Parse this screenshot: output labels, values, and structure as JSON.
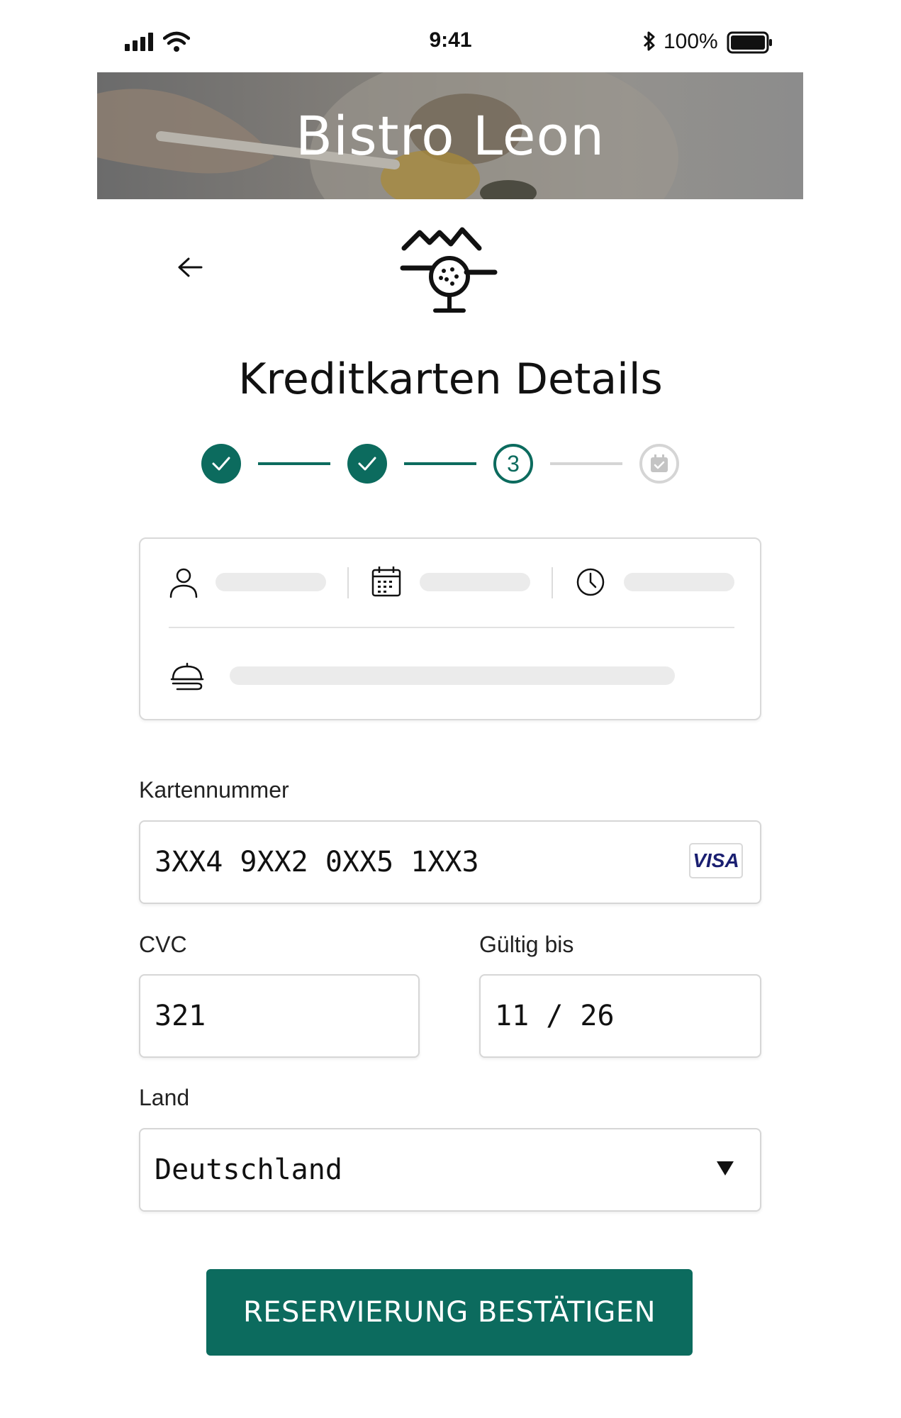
{
  "status_bar": {
    "time": "9:41",
    "battery_percent": "100%"
  },
  "hero": {
    "restaurant_name": "Bistro Leon"
  },
  "page": {
    "title": "Kreditkarten Details"
  },
  "stepper": {
    "steps": [
      {
        "state": "done"
      },
      {
        "state": "done"
      },
      {
        "state": "current",
        "label": "3"
      },
      {
        "state": "pending",
        "icon": "calendar-check-icon"
      }
    ]
  },
  "form": {
    "card_number": {
      "label": "Kartennummer",
      "value": "3XX4 9XX2 0XX5 1XX3",
      "brand": "VISA"
    },
    "cvc": {
      "label": "CVC",
      "value": "321"
    },
    "expiry": {
      "label": "Gültig bis",
      "value": "11 / 26"
    },
    "country": {
      "label": "Land",
      "value": "Deutschland"
    }
  },
  "cta": {
    "label": "RESERVIERUNG BESTÄTIGEN"
  },
  "colors": {
    "accent": "#0c6b5e",
    "inactive": "#d5d5d5",
    "placeholder": "#ebebeb"
  }
}
